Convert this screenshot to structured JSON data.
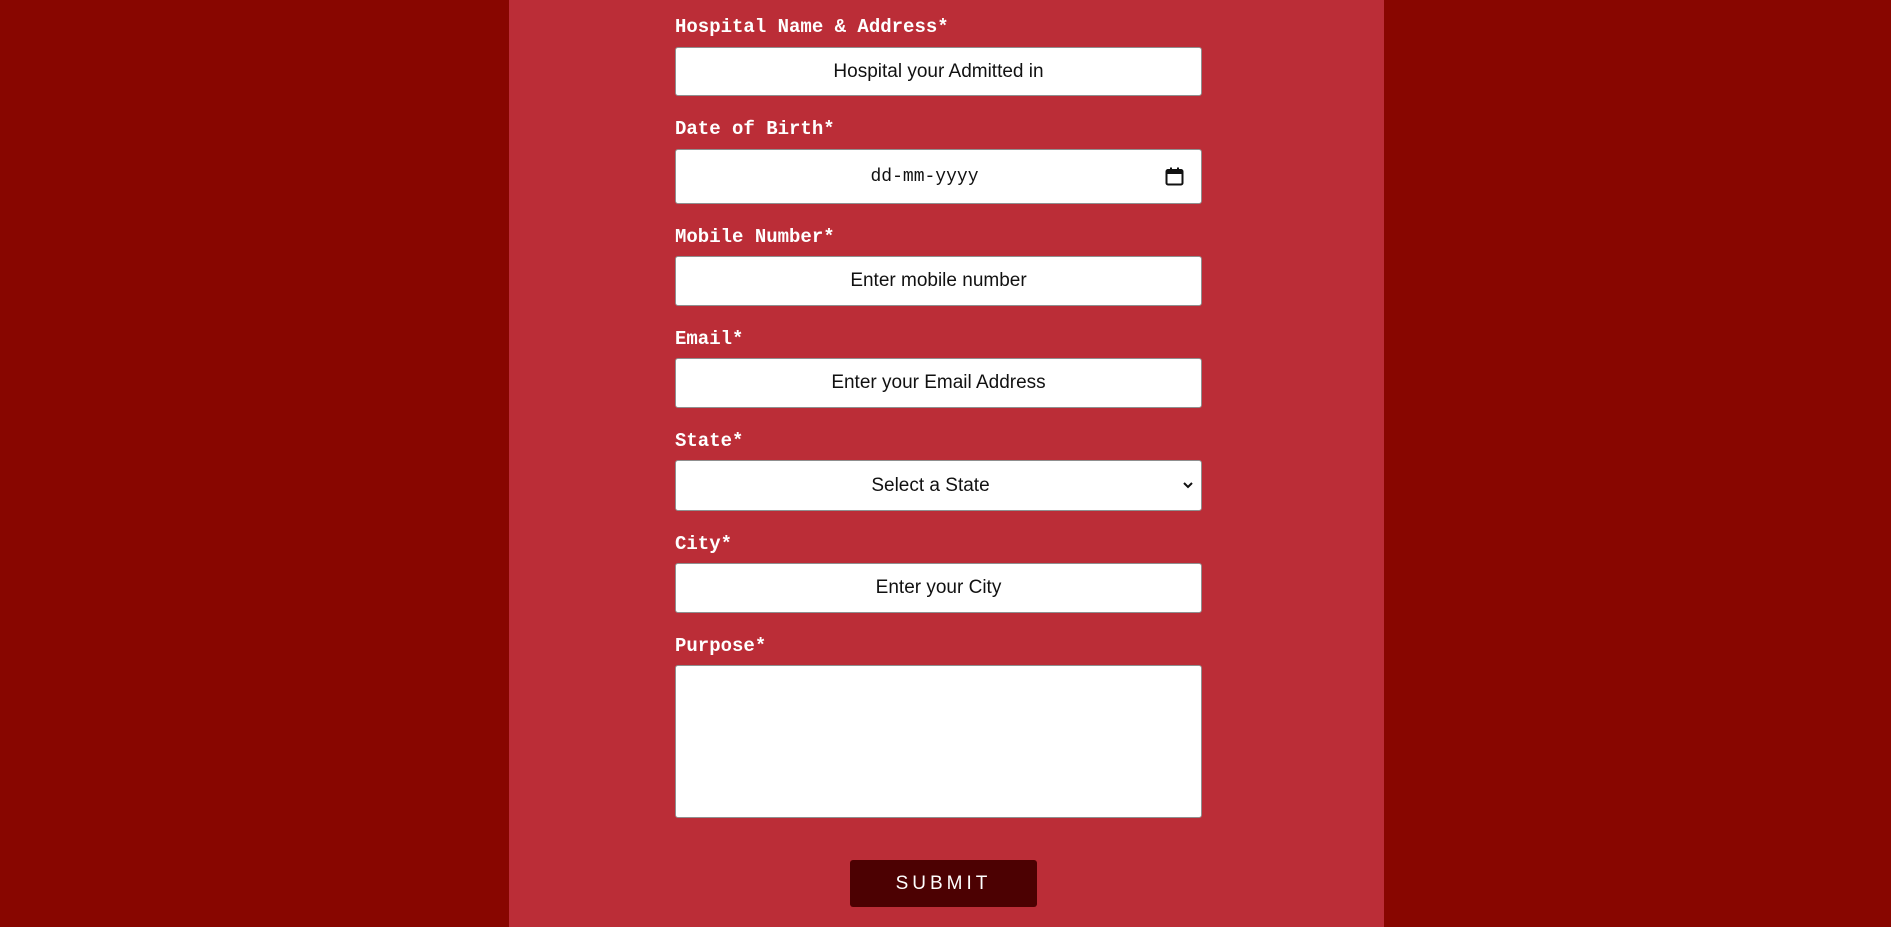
{
  "colors": {
    "outer_background": "#880600",
    "panel_background": "#bb2d37",
    "submit_background": "#4c0102"
  },
  "form": {
    "hospital": {
      "label": "Hospital Name & Address*",
      "placeholder": "Hospital your Admitted in"
    },
    "dob": {
      "label": "Date of Birth*",
      "placeholder": "dd-mm-yyyy"
    },
    "mobile": {
      "label": "Mobile Number*",
      "placeholder": "Enter mobile number"
    },
    "email": {
      "label": "Email*",
      "placeholder": "Enter your Email Address"
    },
    "state": {
      "label": "State*",
      "selected": "Select a State"
    },
    "city": {
      "label": "City*",
      "placeholder": "Enter your City"
    },
    "purpose": {
      "label": "Purpose*",
      "value": ""
    },
    "submit_label": "SUBMIT"
  }
}
